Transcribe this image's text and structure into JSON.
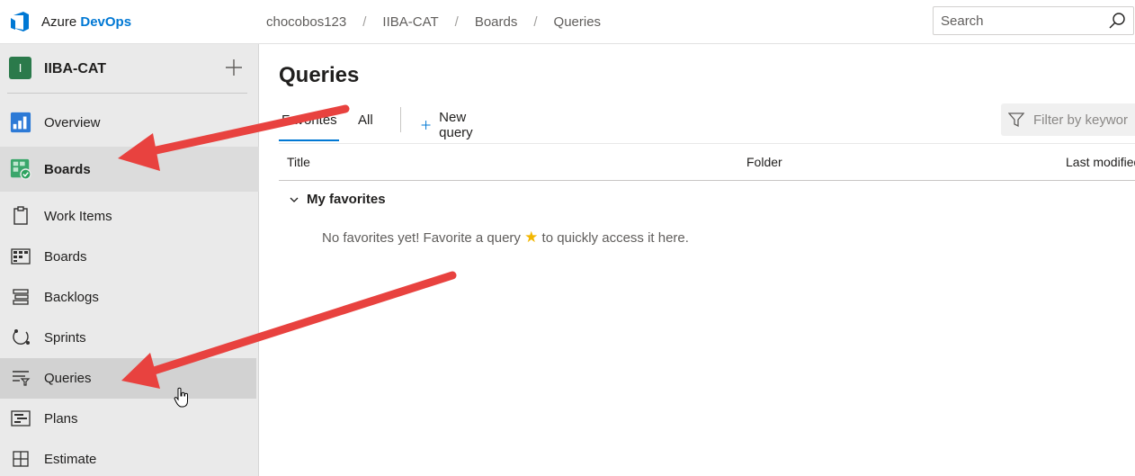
{
  "topbar": {
    "brand_prefix": "Azure",
    "brand_name": "DevOps",
    "breadcrumbs": [
      "chocobos123",
      "IIBA-CAT",
      "Boards",
      "Queries"
    ],
    "search_placeholder": "Search"
  },
  "sidebar": {
    "project_initial": "I",
    "project_name": "IIBA-CAT",
    "items": [
      {
        "label": "Overview",
        "icon": "overview-icon"
      },
      {
        "label": "Boards",
        "icon": "boards-hub-icon"
      },
      {
        "label": "Work Items",
        "icon": "work-items-icon"
      },
      {
        "label": "Boards",
        "icon": "boards-grid-icon"
      },
      {
        "label": "Backlogs",
        "icon": "backlogs-icon"
      },
      {
        "label": "Sprints",
        "icon": "sprints-icon"
      },
      {
        "label": "Queries",
        "icon": "queries-icon"
      },
      {
        "label": "Plans",
        "icon": "plans-icon"
      },
      {
        "label": "Estimate",
        "icon": "estimate-icon"
      }
    ]
  },
  "main": {
    "title": "Queries",
    "tabs": [
      "Favorites",
      "All"
    ],
    "new_query_label": "New query",
    "filter_placeholder": "Filter by keywor",
    "columns": [
      "Title",
      "Folder",
      "Last modified"
    ],
    "group_label": "My favorites",
    "empty_prefix": "No favorites yet! Favorite a query",
    "empty_suffix": "to quickly access it here.",
    "star_glyph": "★"
  },
  "colors": {
    "accent": "#0078d4",
    "annotation_arrow": "#e8423f",
    "project_avatar": "#2b7a4b",
    "star": "#f2b600"
  }
}
